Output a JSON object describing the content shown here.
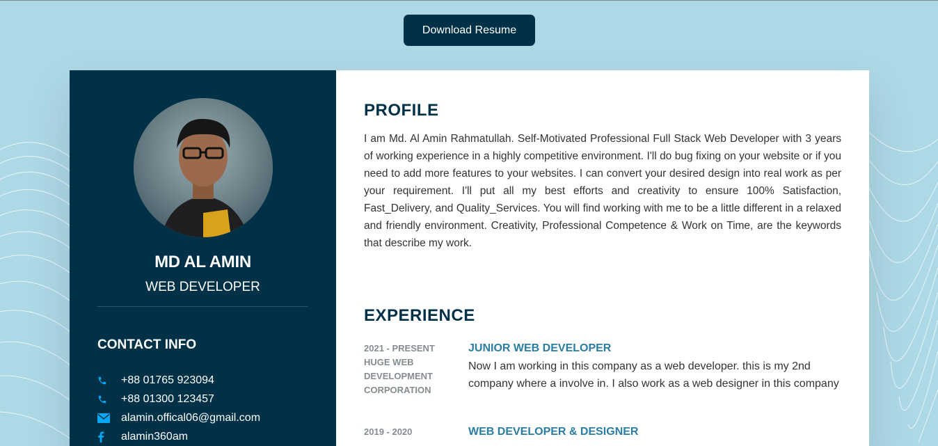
{
  "actions": {
    "download_label": "Download Resume"
  },
  "sidebar": {
    "name": "MD AL AMIN",
    "role": "WEB DEVELOPER",
    "contact_title": "CONTACT INFO",
    "contacts": [
      {
        "icon": "phone-icon",
        "text": "+88 01765 923094"
      },
      {
        "icon": "phone-icon",
        "text": "+88 01300 123457"
      },
      {
        "icon": "email-icon",
        "text": "alamin.offical06@gmail.com"
      },
      {
        "icon": "facebook-icon",
        "text": "alamin360am"
      }
    ]
  },
  "main": {
    "profile_title": "PROFILE",
    "profile_text": "I am Md. Al Amin Rahmatullah. Self-Motivated Professional Full Stack Web Developer with 3 years of working experience in a highly competitive environment. I'll do bug fixing on your website or if you need to add more features to your websites. I can convert your desired design into real work as per your requirement. I'll put all my best efforts and creativity to ensure 100% Satisfaction, Fast_Delivery, and Quality_Services. You will find working with me to be a little different in a relaxed and friendly environment. Creativity, Professional Competence & Work on Time, are the keywords that describe my work.",
    "experience_title": "EXPERIENCE",
    "experience": [
      {
        "period": "2021 - PRESENT",
        "company": "HUGE WEB DEVELOPMENT CORPORATION",
        "title": "JUNIOR WEB DEVELOPER",
        "description": "Now I am working in this company as a web developer. this is my 2nd company where a involve in. I also work as a web designer in this company"
      },
      {
        "period": "2019 - 2020",
        "company": "",
        "title": "WEB DEVELOPER & DESIGNER",
        "description": ""
      }
    ]
  },
  "colors": {
    "background": "#add8e6",
    "sidebar": "#003147",
    "accent": "#2a7da2",
    "icon": "#03a9f4"
  }
}
